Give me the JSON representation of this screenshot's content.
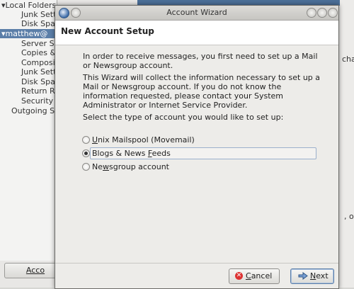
{
  "background": {
    "tree": {
      "items": [
        {
          "label": "Local Folders",
          "prefix": "▾",
          "selected": false
        },
        {
          "label": "Junk Sett",
          "prefix": "",
          "selected": false
        },
        {
          "label": "Disk Spac",
          "prefix": "",
          "selected": false
        },
        {
          "label": "matthew@",
          "prefix": "▾",
          "selected": true
        },
        {
          "label": "Server Se",
          "prefix": "",
          "selected": false
        },
        {
          "label": "Copies &",
          "prefix": "",
          "selected": false
        },
        {
          "label": "Composit",
          "prefix": "",
          "selected": false
        },
        {
          "label": "Junk Sett",
          "prefix": "",
          "selected": false
        },
        {
          "label": "Disk Spac",
          "prefix": "",
          "selected": false
        },
        {
          "label": "Return R",
          "prefix": "",
          "selected": false
        },
        {
          "label": "Security",
          "prefix": "",
          "selected": false
        },
        {
          "label": "Outgoing Se",
          "prefix": "",
          "selected": false
        }
      ]
    },
    "accounts_button": {
      "label": "Acco"
    },
    "right_fragments": [
      "cha",
      ", or"
    ]
  },
  "dialog": {
    "title": "Account Wizard",
    "header": "New Account Setup",
    "paragraphs": [
      "In order to receive messages, you first need to set up a Mail or Newsgroup account.",
      "This Wizard will collect the information necessary to set up a Mail or Newsgroup account. If you do not know the information requested, please contact your System Administrator or Internet Service Provider."
    ],
    "select_label": "Select the type of account you would like to set up:",
    "options": [
      {
        "mnemonic_pre": "",
        "mnemonic": "U",
        "mnemonic_post": "nix Mailspool (Movemail)",
        "checked": false
      },
      {
        "mnemonic_pre": "Blogs & News ",
        "mnemonic": "F",
        "mnemonic_post": "eeds",
        "checked": true
      },
      {
        "mnemonic_pre": "Ne",
        "mnemonic": "w",
        "mnemonic_post": "sgroup account",
        "checked": false
      }
    ],
    "buttons": {
      "cancel": {
        "pre": "",
        "mnemonic": "C",
        "post": "ancel"
      },
      "next": {
        "pre": "",
        "mnemonic": "N",
        "post": "ext"
      }
    }
  },
  "colors": {
    "selection": "#5b7ea8",
    "header_bg": "#ffffff",
    "dialog_bg": "#edece9",
    "cancel_icon": "#dd3333"
  }
}
